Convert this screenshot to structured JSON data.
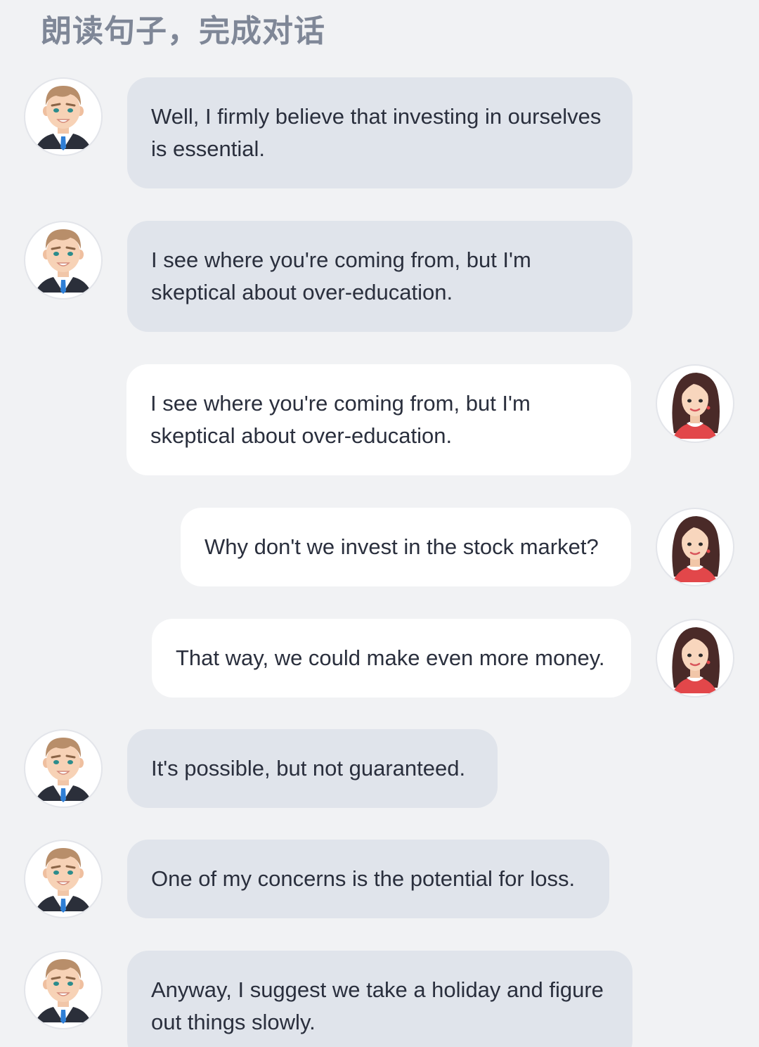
{
  "header": {
    "title": "朗读句子，完成对话"
  },
  "icons": {
    "male_avatar": "male-avatar-icon",
    "female_avatar": "female-avatar-icon"
  },
  "colors": {
    "background": "#f1f2f4",
    "left_bubble": "#e0e4eb",
    "right_bubble": "#ffffff",
    "title_text": "#7f8797",
    "message_text": "#2a2f3d"
  },
  "messages": [
    {
      "speaker": "male",
      "side": "left",
      "text": "Well, I firmly believe that investing in ourselves is essential."
    },
    {
      "speaker": "male",
      "side": "left",
      "text": "I see where you're coming from, but I'm skeptical about over-education."
    },
    {
      "speaker": "female",
      "side": "right",
      "text": "I see where you're coming from, but I'm skeptical about over-education."
    },
    {
      "speaker": "female",
      "side": "right",
      "text": "Why don't we invest in the stock market?"
    },
    {
      "speaker": "female",
      "side": "right",
      "text": "That way, we could make even more money."
    },
    {
      "speaker": "male",
      "side": "left",
      "text": "It's possible, but not guaranteed."
    },
    {
      "speaker": "male",
      "side": "left",
      "text": "One of my concerns is the potential for loss."
    },
    {
      "speaker": "male",
      "side": "left",
      "text": "Anyway, I suggest we take a holiday and figure out things slowly."
    }
  ]
}
